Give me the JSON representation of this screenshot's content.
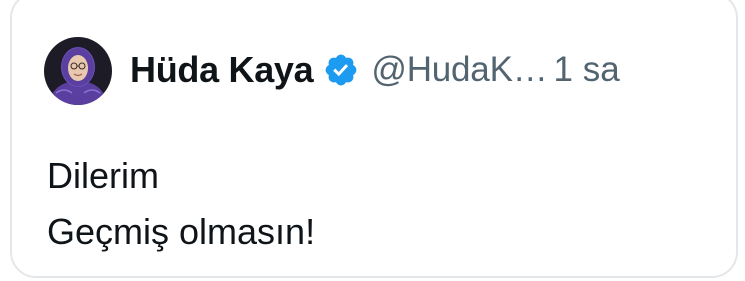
{
  "tweet": {
    "author": {
      "display_name": "Hüda Kaya",
      "handle": "@HudaK…",
      "verified": true,
      "verified_color": "#1d9bf0"
    },
    "time": "1 sa",
    "lines": [
      "Dilerim",
      "Geçmiş olmasın!"
    ]
  },
  "colors": {
    "text_primary": "#0f1419",
    "text_secondary": "#536471",
    "border": "#e3e7ea",
    "headscarf": "#5a3fa0"
  },
  "icons": {
    "avatar": "profile-photo",
    "verified": "verified-badge-icon"
  }
}
